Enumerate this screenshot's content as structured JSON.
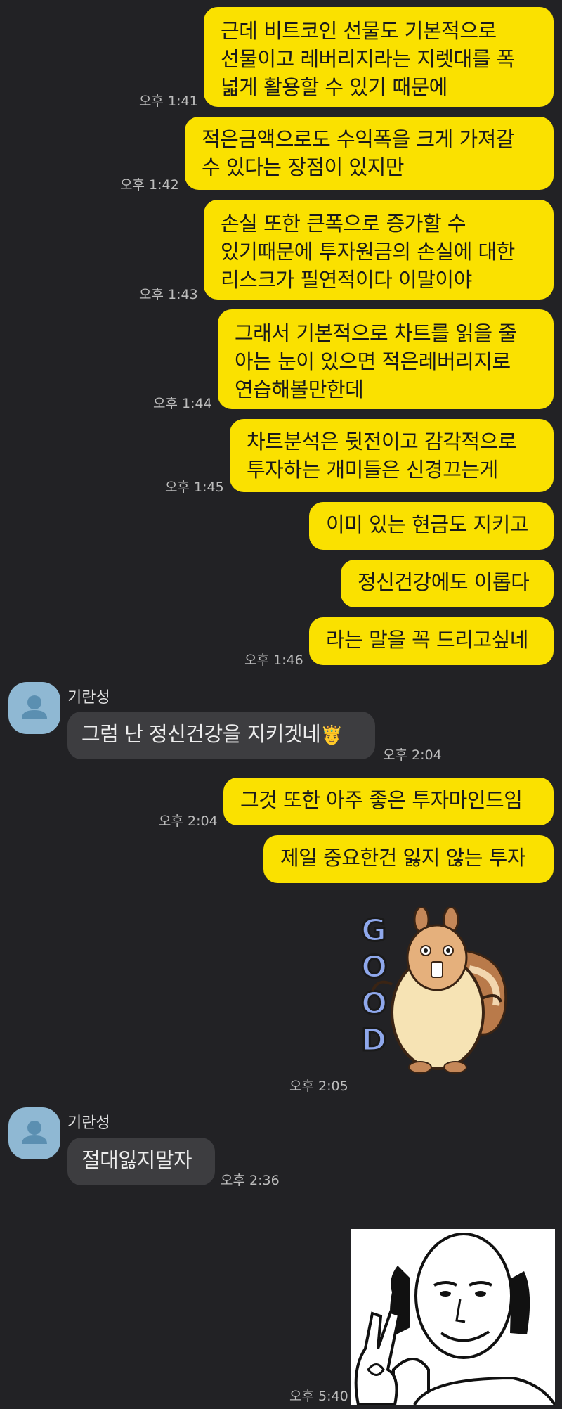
{
  "chat": {
    "messages": [
      {
        "text": "근데 비트코인 선물도 기본적으로\n선물이고 레버리지라는 지렛대를 폭\n넓게 활용할 수 있기 때문에",
        "time": "오후 1:41"
      },
      {
        "text": "적은금액으로도 수익폭을 크게 가져갈\n수 있다는 장점이 있지만",
        "time": "오후 1:42"
      },
      {
        "text": "손실 또한 큰폭으로 증가할 수\n있기때문에 투자원금의 손실에 대한\n리스크가 필연적이다 이말이야",
        "time": "오후 1:43"
      },
      {
        "text": "그래서 기본적으로 차트를 읽을 줄\n아는 눈이 있으면 적은레버리지로\n연습해볼만한데",
        "time": "오후 1:44"
      },
      {
        "text": "차트분석은 뒷전이고 감각적으로\n투자하는 개미들은 신경끄는게",
        "time": "오후 1:45"
      },
      {
        "text": "이미 있는 현금도 지키고",
        "time": ""
      },
      {
        "text": "정신건강에도 이롭다",
        "time": ""
      },
      {
        "text": "라는 말을 꼭 드리고싶네",
        "time": "오후 1:46"
      },
      {
        "sender": "기란성",
        "text": "그럼 난 정신건강을 지키겟네",
        "emoji": "🤴",
        "time": "오후 2:04"
      },
      {
        "text": "그것 또한 아주 좋은 투자마인드임",
        "time": "오후 2:04"
      },
      {
        "text": "제일 중요한건 잃지 않는 투자",
        "time": ""
      },
      {
        "sticker": "squirrel-good-sticker",
        "sticker_text": "GOOD",
        "time": "오후 2:05"
      },
      {
        "sender": "기란성",
        "text": "절대잃지말자",
        "time": "오후 2:36"
      },
      {
        "sticker": "bald-man-ok-sticker",
        "time": "오후 5:40"
      }
    ]
  },
  "colors": {
    "background": "#222225",
    "my_bubble": "#fae100",
    "other_bubble": "#3d3d40",
    "avatar": "#8fb8d3"
  }
}
